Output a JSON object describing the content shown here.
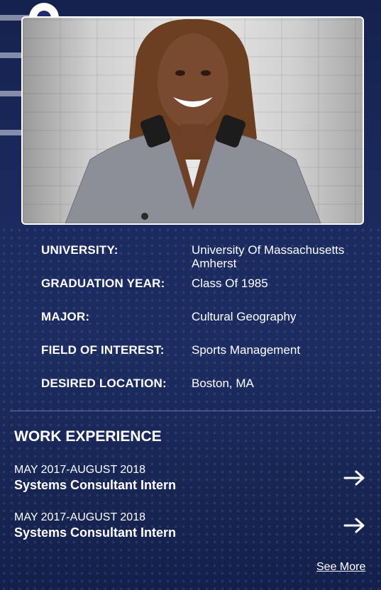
{
  "profile": {
    "photo_icon": "profile-photo",
    "fields": [
      {
        "label": "UNIVERSITY:",
        "value": "University Of Massachusetts Amherst"
      },
      {
        "label": "GRADUATION YEAR:",
        "value": "Class Of 1985"
      },
      {
        "label": "MAJOR:",
        "value": "Cultural Geography"
      },
      {
        "label": "FIELD OF INTEREST:",
        "value": "Sports Management"
      },
      {
        "label": "DESIRED LOCATION:",
        "value": "Boston, MA"
      }
    ]
  },
  "stepper": {
    "total_steps": 4,
    "active_step": 1
  },
  "work": {
    "title": "WORK EXPERIENCE",
    "items": [
      {
        "dates": "MAY 2017-AUGUST 2018",
        "title": "Systems Consultant Intern",
        "icon": "arrow-right-icon"
      },
      {
        "dates": "MAY 2017-AUGUST 2018",
        "title": "Systems Consultant Intern",
        "icon": "arrow-right-icon"
      }
    ],
    "see_more": "See More"
  },
  "colors": {
    "background": "#1a2a5e",
    "text": "#ffffff",
    "step_core": "#2b3b86"
  }
}
